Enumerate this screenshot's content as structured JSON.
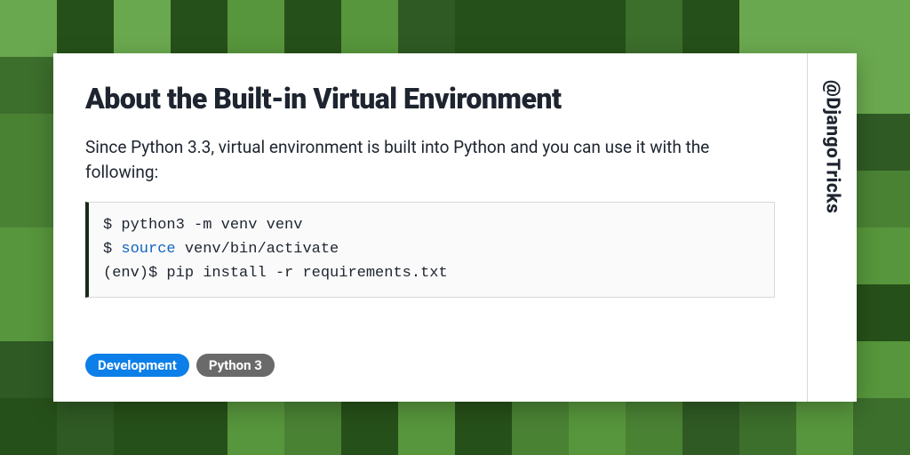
{
  "bg_palette": [
    "#2f5a24",
    "#3c6e2c",
    "#4a8234",
    "#57963c",
    "#265019",
    "#6aa84f"
  ],
  "card": {
    "title": "About the Built-in Virtual Environment",
    "description": "Since Python 3.3, virtual environment is built into Python and you can use it with the following:",
    "code": {
      "line1_prompt": "$ ",
      "line1_rest": "python3 -m venv venv",
      "line2_prompt": "$ ",
      "line2_kw": "source",
      "line2_rest": " venv/bin/activate",
      "line3_prompt": "(env)$ ",
      "line3_rest": "pip install -r requirements.txt"
    },
    "tags": [
      {
        "label": "Development",
        "variant": "blue"
      },
      {
        "label": "Python 3",
        "variant": "gray"
      }
    ],
    "handle": "@DjangoTricks"
  }
}
